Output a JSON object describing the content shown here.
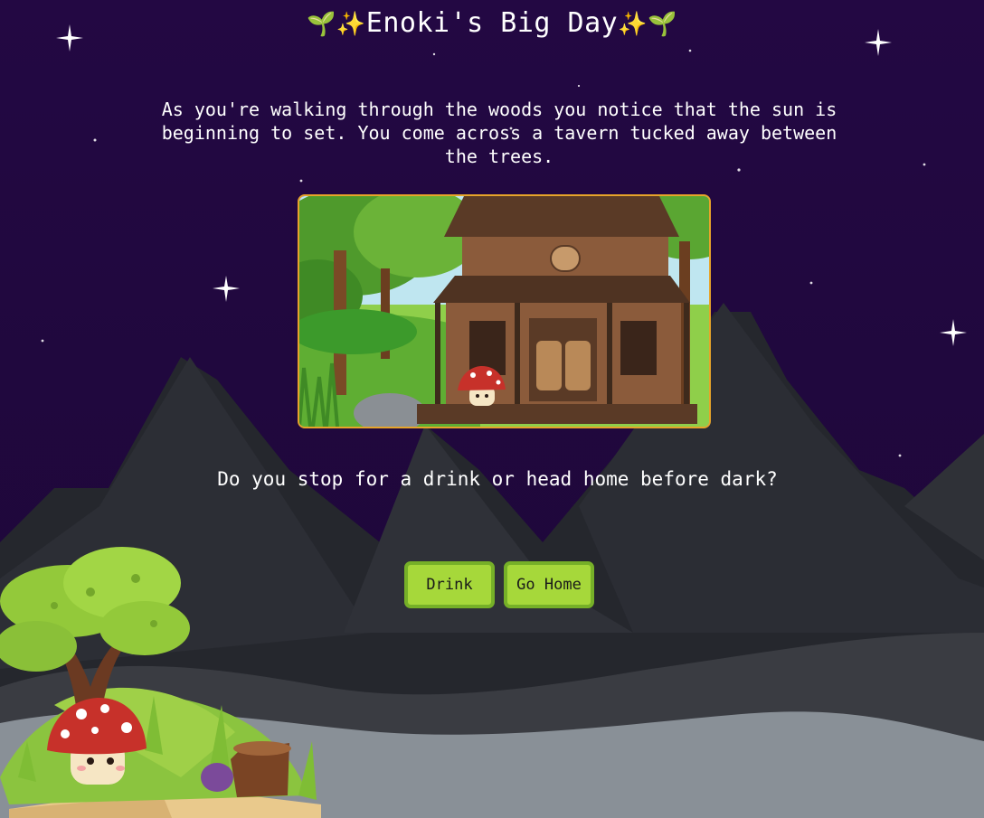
{
  "title": {
    "emoji_left": "🌱✨",
    "text": "Enoki's Big Day",
    "emoji_right": "✨🌱"
  },
  "story_text": "As you're walking through the woods you notice that the sun is beginning to set. You come across a tavern tucked away between the trees.",
  "scene_image": {
    "subject": "tavern in the woods with mushroom character",
    "border_color": "#e7a42a"
  },
  "question": "Do you stop for a drink or head home before dark?",
  "choices": {
    "drink_label": "Drink",
    "home_label": "Go Home"
  },
  "colors": {
    "night_sky": "#20073f",
    "mountains": "#2a2c33",
    "button": "#a6d83a",
    "button_border": "#76b028",
    "mushroom_cap": "#c7312a"
  },
  "icons": [
    "sparkle-star-icon",
    "sprout-emoji",
    "sparkles-emoji",
    "mushroom-character",
    "open-book-illustration"
  ]
}
